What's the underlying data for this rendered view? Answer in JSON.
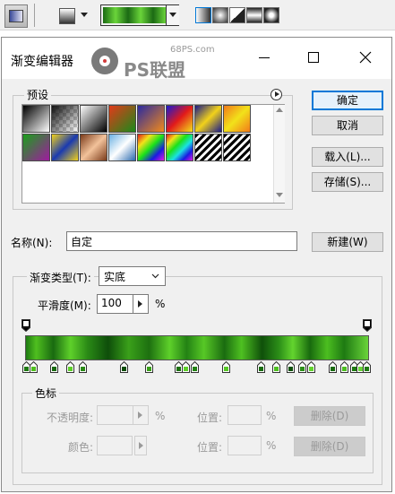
{
  "toolbar": {
    "tools": [
      "linear-gradient",
      "radial-gradient",
      "angle-gradient",
      "reflected-gradient",
      "diamond-gradient"
    ]
  },
  "dialog": {
    "title": "渐变编辑器",
    "watermark_site": "68PS.com",
    "watermark_brand": "PS联盟",
    "presets_label": "预设",
    "buttons": {
      "ok": "确定",
      "cancel": "取消",
      "load": "载入(L)...",
      "save": "存储(S)...",
      "new": "新建(W)",
      "delete": "删除(D)"
    },
    "name_label": "名称(N):",
    "name_value": "自定",
    "gradient_type_label": "渐变类型(T):",
    "gradient_type_value": "实底",
    "smoothness_label": "平滑度(M):",
    "smoothness_value": "100",
    "percent": "%",
    "color_stops_label": "色标",
    "opacity_label": "不透明度:",
    "location_label": "位置:",
    "color_label": "颜色:"
  },
  "colors": {
    "green_dark": "#0a5a0a",
    "green_light": "#5ed02a",
    "accent": "#0078d7"
  }
}
